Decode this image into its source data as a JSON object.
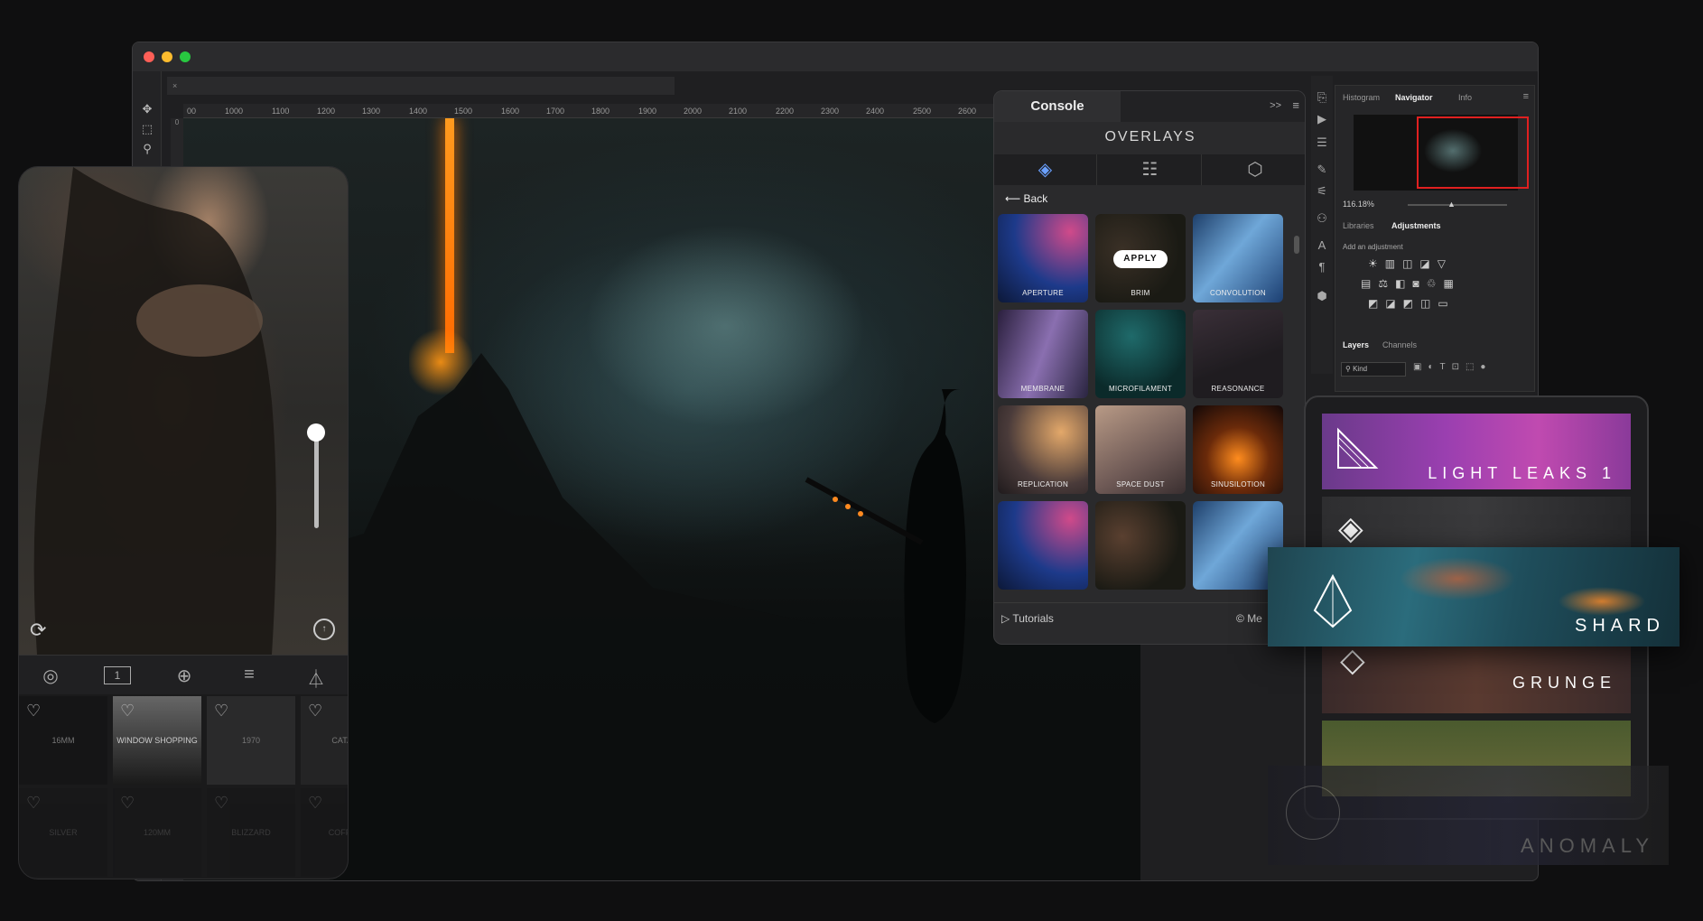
{
  "window": {
    "ruler_marks": [
      "00",
      "1000",
      "1100",
      "1200",
      "1300",
      "1400",
      "1500",
      "1600",
      "1700",
      "1800",
      "1900",
      "2000",
      "2100",
      "2200",
      "2300",
      "2400",
      "2500",
      "2600"
    ],
    "vruler_mark": "0",
    "tab_close": "×",
    "toolbox_icons": [
      "move-icon",
      "marquee-icon",
      "magic-wand-icon"
    ]
  },
  "phone": {
    "toolbar_icons": [
      "blend-icon",
      "frame-icon",
      "add-icon",
      "sliders-icon",
      "flask-icon"
    ],
    "frame_badge": "1",
    "films_row1": [
      "16MM",
      "WINDOW SHOPPING",
      "1970",
      "CATAR"
    ],
    "films_row2": [
      "SILVER",
      "120MM",
      "BLIZZARD",
      "COFFEE"
    ]
  },
  "console": {
    "tab_label": "Console",
    "expand": ">>",
    "title": "OVERLAYS",
    "back_label": "Back",
    "apply_label": "APPLY",
    "tiles": [
      {
        "label": "APERTURE"
      },
      {
        "label": "BRIM"
      },
      {
        "label": "CONVOLUTION"
      },
      {
        "label": "MEMBRANE"
      },
      {
        "label": "MICROFILAMENT"
      },
      {
        "label": "REASONANCE"
      },
      {
        "label": "REPLICATION"
      },
      {
        "label": "SPACE DUST"
      },
      {
        "label": "SINUSILOTION"
      },
      {
        "label": ""
      },
      {
        "label": ""
      },
      {
        "label": ""
      }
    ],
    "footer_tutorials": "Tutorials",
    "footer_more": "Me"
  },
  "ps_panels": {
    "top_tabs": [
      "Histogram",
      "Navigator",
      "Info"
    ],
    "zoom": "116.18%",
    "mid_tabs": [
      "Libraries",
      "Adjustments"
    ],
    "add_adjustment": "Add an adjustment",
    "bottom_tabs": [
      "Layers",
      "Channels"
    ],
    "kind_filter": "Kind"
  },
  "tablet": {
    "banners": [
      "LIGHT LEAKS 1",
      "",
      "SHARD",
      "GRUNGE",
      "",
      "ANOMALY"
    ]
  }
}
